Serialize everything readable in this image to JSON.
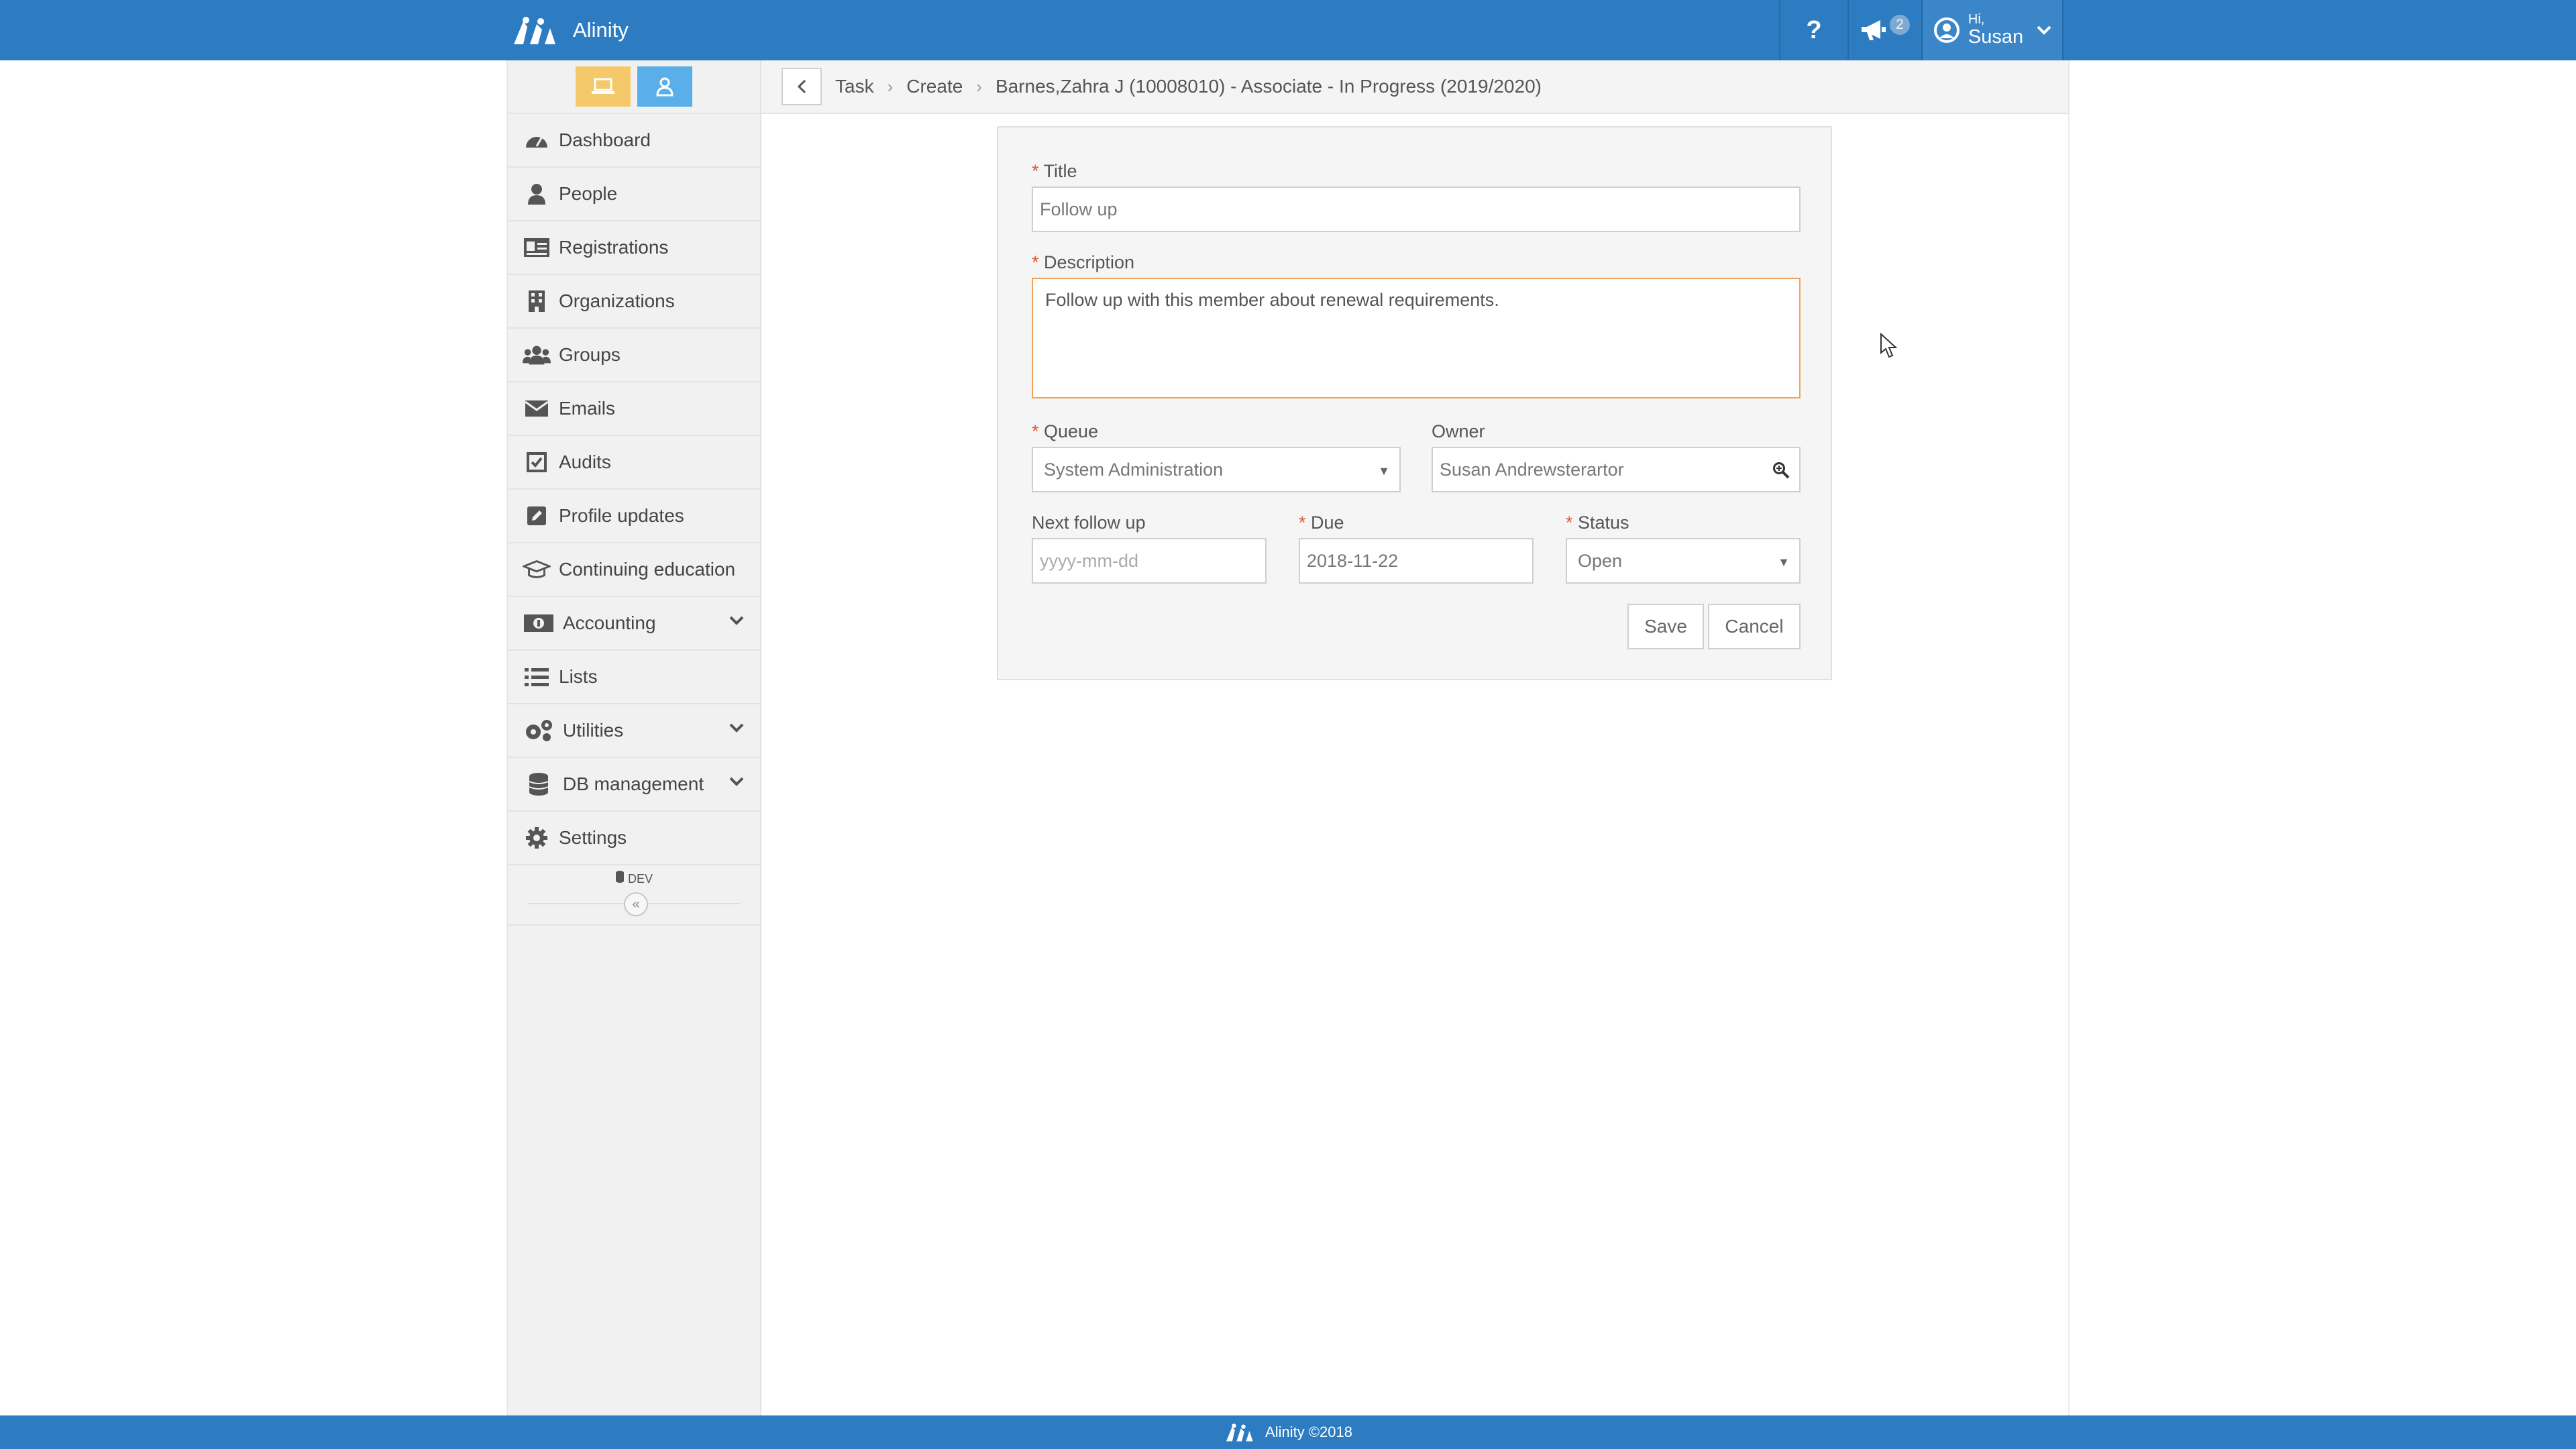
{
  "app": {
    "name": "Alinity",
    "brand_color": "#2d7cc1"
  },
  "topbar": {
    "help_icon": "question-icon",
    "notifications_icon": "megaphone-icon",
    "notifications_count": "2",
    "user_greeting": "Hi,",
    "user_name": "Susan"
  },
  "sidebar": {
    "items": [
      {
        "label": "Dashboard",
        "icon": "dashboard-icon"
      },
      {
        "label": "People",
        "icon": "person-icon"
      },
      {
        "label": "Registrations",
        "icon": "id-card-icon"
      },
      {
        "label": "Organizations",
        "icon": "building-icon"
      },
      {
        "label": "Groups",
        "icon": "users-icon"
      },
      {
        "label": "Emails",
        "icon": "envelope-icon"
      },
      {
        "label": "Audits",
        "icon": "checkbox-icon"
      },
      {
        "label": "Profile updates",
        "icon": "edit-icon"
      },
      {
        "label": "Continuing education",
        "icon": "graduation-cap-icon"
      },
      {
        "label": "Accounting",
        "icon": "money-icon",
        "expandable": true
      },
      {
        "label": "Lists",
        "icon": "list-icon"
      },
      {
        "label": "Utilities",
        "icon": "cogs-icon",
        "expandable": true
      },
      {
        "label": "DB management",
        "icon": "database-icon",
        "expandable": true
      },
      {
        "label": "Settings",
        "icon": "gear-icon"
      }
    ],
    "env_label": "DEV",
    "collapse_glyph": "«"
  },
  "breadcrumb": {
    "items": [
      "Task",
      "Create",
      "Barnes,Zahra J (10008010) - Associate - In Progress (2019/2020)"
    ]
  },
  "form": {
    "title": {
      "label": "Title",
      "value": "Follow up"
    },
    "description": {
      "label": "Description",
      "value": "Follow up with this member about renewal requirements."
    },
    "queue": {
      "label": "Queue",
      "value": "System Administration"
    },
    "owner": {
      "label": "Owner",
      "value": "Susan Andrewsterartor"
    },
    "next_follow_up": {
      "label": "Next follow up",
      "placeholder": "yyyy-mm-dd"
    },
    "due": {
      "label": "Due",
      "value": "2018-11-22"
    },
    "status": {
      "label": "Status",
      "value": "Open"
    },
    "save_label": "Save",
    "cancel_label": "Cancel"
  },
  "footer": {
    "text": "Alinity ©2018"
  }
}
